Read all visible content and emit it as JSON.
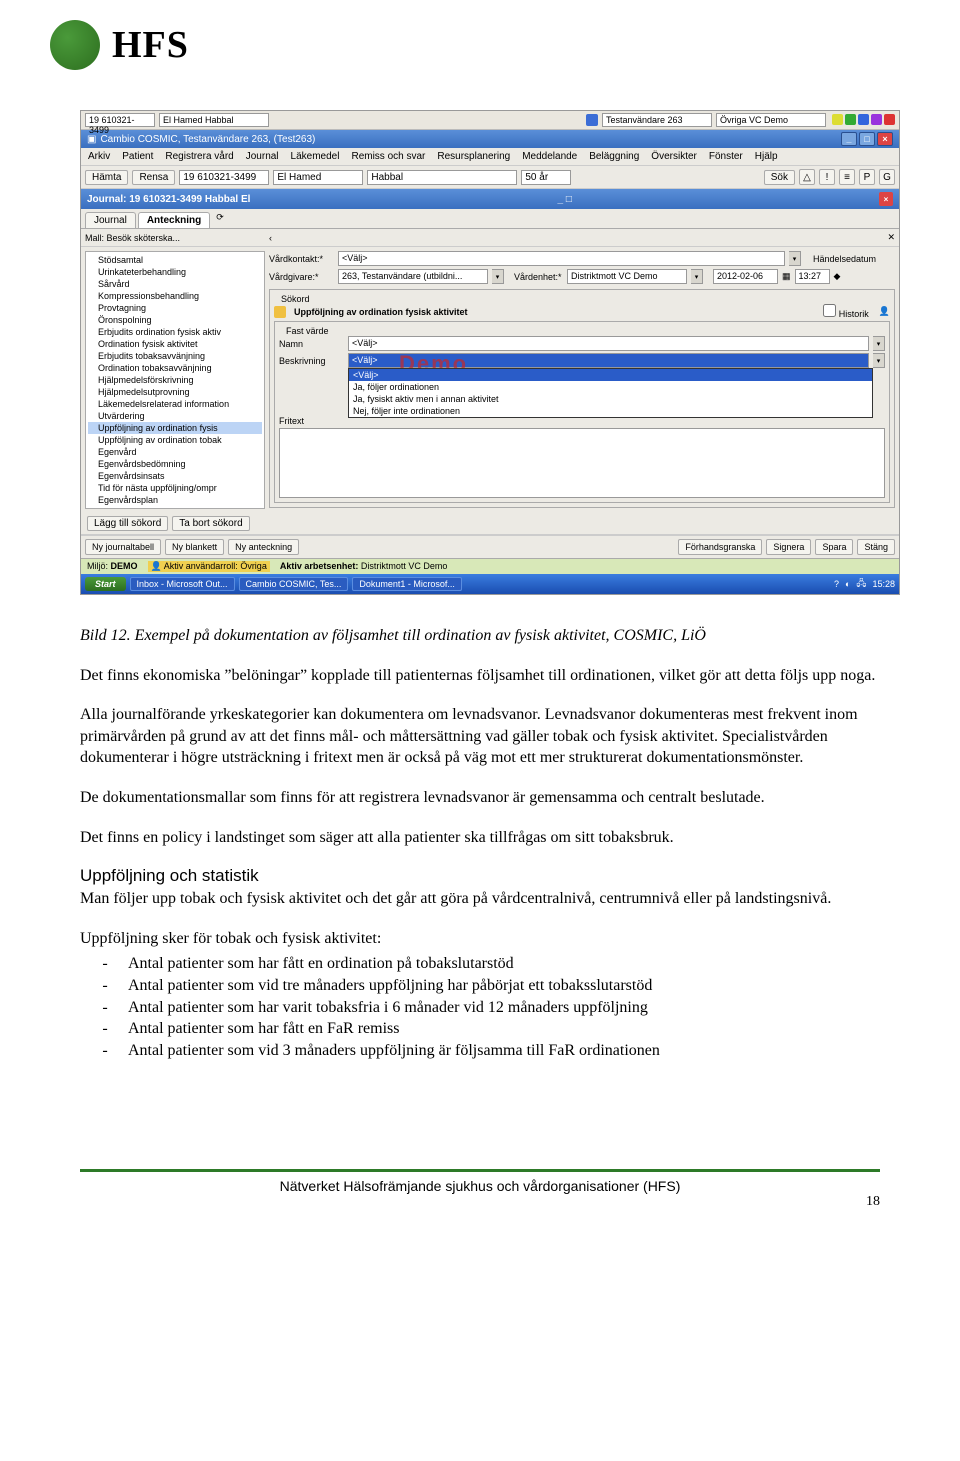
{
  "header": {
    "logo_text": "HFS"
  },
  "screenshot": {
    "topbar": {
      "id": "19 610321-3499",
      "name": "El Hamed Habbal",
      "user": "Testanvändare 263",
      "extra": "Övriga VC Demo"
    },
    "title": "Cambio COSMIC, Testanvändare 263, (Test263)",
    "menu": [
      "Arkiv",
      "Patient",
      "Registrera vård",
      "Journal",
      "Läkemedel",
      "Remiss och svar",
      "Resursplanering",
      "Meddelande",
      "Beläggning",
      "Översikter",
      "Fönster",
      "Hjälp"
    ],
    "toolbar": {
      "hamta": "Hämta",
      "rensa": "Rensa",
      "f1": "19 610321-3499",
      "f2": "El Hamed",
      "f3": "Habbal",
      "f4": "50 år",
      "sok": "Sök",
      "p": "P",
      "g": "G"
    },
    "journal_title": "Journal: 19 610321-3499 Habbal El",
    "tabs": {
      "t1": "Journal",
      "t2": "Anteckning"
    },
    "tree_top": "Mall:  Besök sköterska...",
    "tree": [
      "Stödsamtal",
      "Urinkateterbehandling",
      "Sårvård",
      "Kompressionsbehandling",
      "Provtagning",
      "Öronspolning",
      "Erbjudits ordination fysisk aktiv",
      "Ordination fysisk aktivitet",
      "Erbjudits tobaksavvänjning",
      "Ordination tobaksavvänjning",
      "Hjälpmedelsförskrivning",
      "Hjälpmedelsutprovning",
      "Läkemedelsrelaterad information",
      "Utvärdering",
      "Uppföljning av ordination fysis",
      "Uppföljning av ordination tobak",
      "Egenvård",
      "Egenvårdsbedömning",
      "Egenvårdsinsats",
      "Tid för nästa uppföljning/ompr",
      "Egenvårdsplan"
    ],
    "tree_selected_index": 14,
    "tree_buttons": {
      "add": "Lägg till sökord",
      "del": "Ta bort sökord"
    },
    "right": {
      "vardkontakt_lbl": "Vårdkontakt:*",
      "vardkontakt_val": "<Välj>",
      "vardgivare_lbl": "Vårdgivare:*",
      "vardgivare_val": "263, Testanvändare (utbildni...",
      "vardenhet_lbl": "Vårdenhet:*",
      "vardenhet_val": "Distriktmott VC Demo",
      "handelsedatum_lbl": "Händelsedatum",
      "handelsedatum_val": "2012-02-06",
      "handelsedatum_time": "13:27",
      "sokord_lbl": "Sökord",
      "uppf_title": "Uppföljning av ordination fysisk aktivitet",
      "historik": "Historik",
      "fastvarde_lbl": "Fast värde",
      "namn_lbl": "Namn",
      "namn_val": "<Välj>",
      "beskrivning_lbl": "Beskrivning",
      "options": [
        "<Välj>",
        "Ja, följer ordinationen",
        "Ja, fysiskt aktiv men i annan aktivitet",
        "Nej, följer inte ordinationen"
      ],
      "opt_selected": 0,
      "fritext_lbl": "Fritext",
      "watermark": "Demo"
    },
    "bottom_buttons": {
      "b1": "Ny journaltabell",
      "b2": "Ny blankett",
      "b3": "Ny anteckning",
      "r1": "Förhandsgranska",
      "r2": "Signera",
      "r3": "Spara",
      "r4": "Stäng"
    },
    "status": {
      "miljo_lbl": "Miljö:",
      "miljo": "DEMO",
      "roll_lbl": "Aktiv användarroll:",
      "roll": "Övriga",
      "enhet_lbl": "Aktiv arbetsenhet:",
      "enhet": "Distriktmott VC Demo"
    },
    "taskbar": {
      "start": "Start",
      "t1": "Inbox - Microsoft Out...",
      "t2": "Cambio COSMIC, Tes...",
      "t3": "Dokument1 - Microsof...",
      "clock": "15:28"
    }
  },
  "body": {
    "caption": "Bild 12. Exempel på dokumentation av följsamhet till ordination av fysisk aktivitet, COSMIC, LiÖ",
    "p1": "Det finns ekonomiska ”belöningar” kopplade till patienternas följsamhet till ordinationen, vilket gör att detta följs upp noga.",
    "p2": "Alla journalförande yrkeskategorier kan dokumentera om levnadsvanor. Levnadsvanor dokumenteras mest frekvent inom primärvården på grund av att det finns mål- och måttersättning vad gäller tobak och fysisk aktivitet. Specialistvården dokumenterar i högre utsträckning i fritext men är också på väg mot ett mer strukturerat dokumentationsmönster.",
    "p3": "De dokumentationsmallar som finns för att registrera levnadsvanor är gemensamma och centralt beslutade.",
    "p4": "Det finns en policy i landstinget som säger att alla patienter ska tillfrågas om sitt tobaksbruk.",
    "h3": "Uppföljning och statistik",
    "p5": "Man följer upp tobak och fysisk aktivitet och det går att göra på vårdcentralnivå, centrumnivå eller på landstingsnivå.",
    "p6": "Uppföljning sker för tobak och fysisk aktivitet:",
    "bullets": [
      "Antal patienter som har fått en ordination på tobakslutarstöd",
      "Antal patienter som vid tre månaders uppföljning har påbörjat ett tobaksslutarstöd",
      "Antal patienter som har varit tobaksfria i 6 månader vid 12 månaders uppföljning",
      "Antal patienter som har fått en FaR remiss",
      "Antal patienter som vid 3 månaders uppföljning är följsamma till FaR ordinationen"
    ]
  },
  "footer": {
    "text": "Nätverket Hälsofrämjande sjukhus och vårdorganisationer (HFS)",
    "page": "18"
  }
}
